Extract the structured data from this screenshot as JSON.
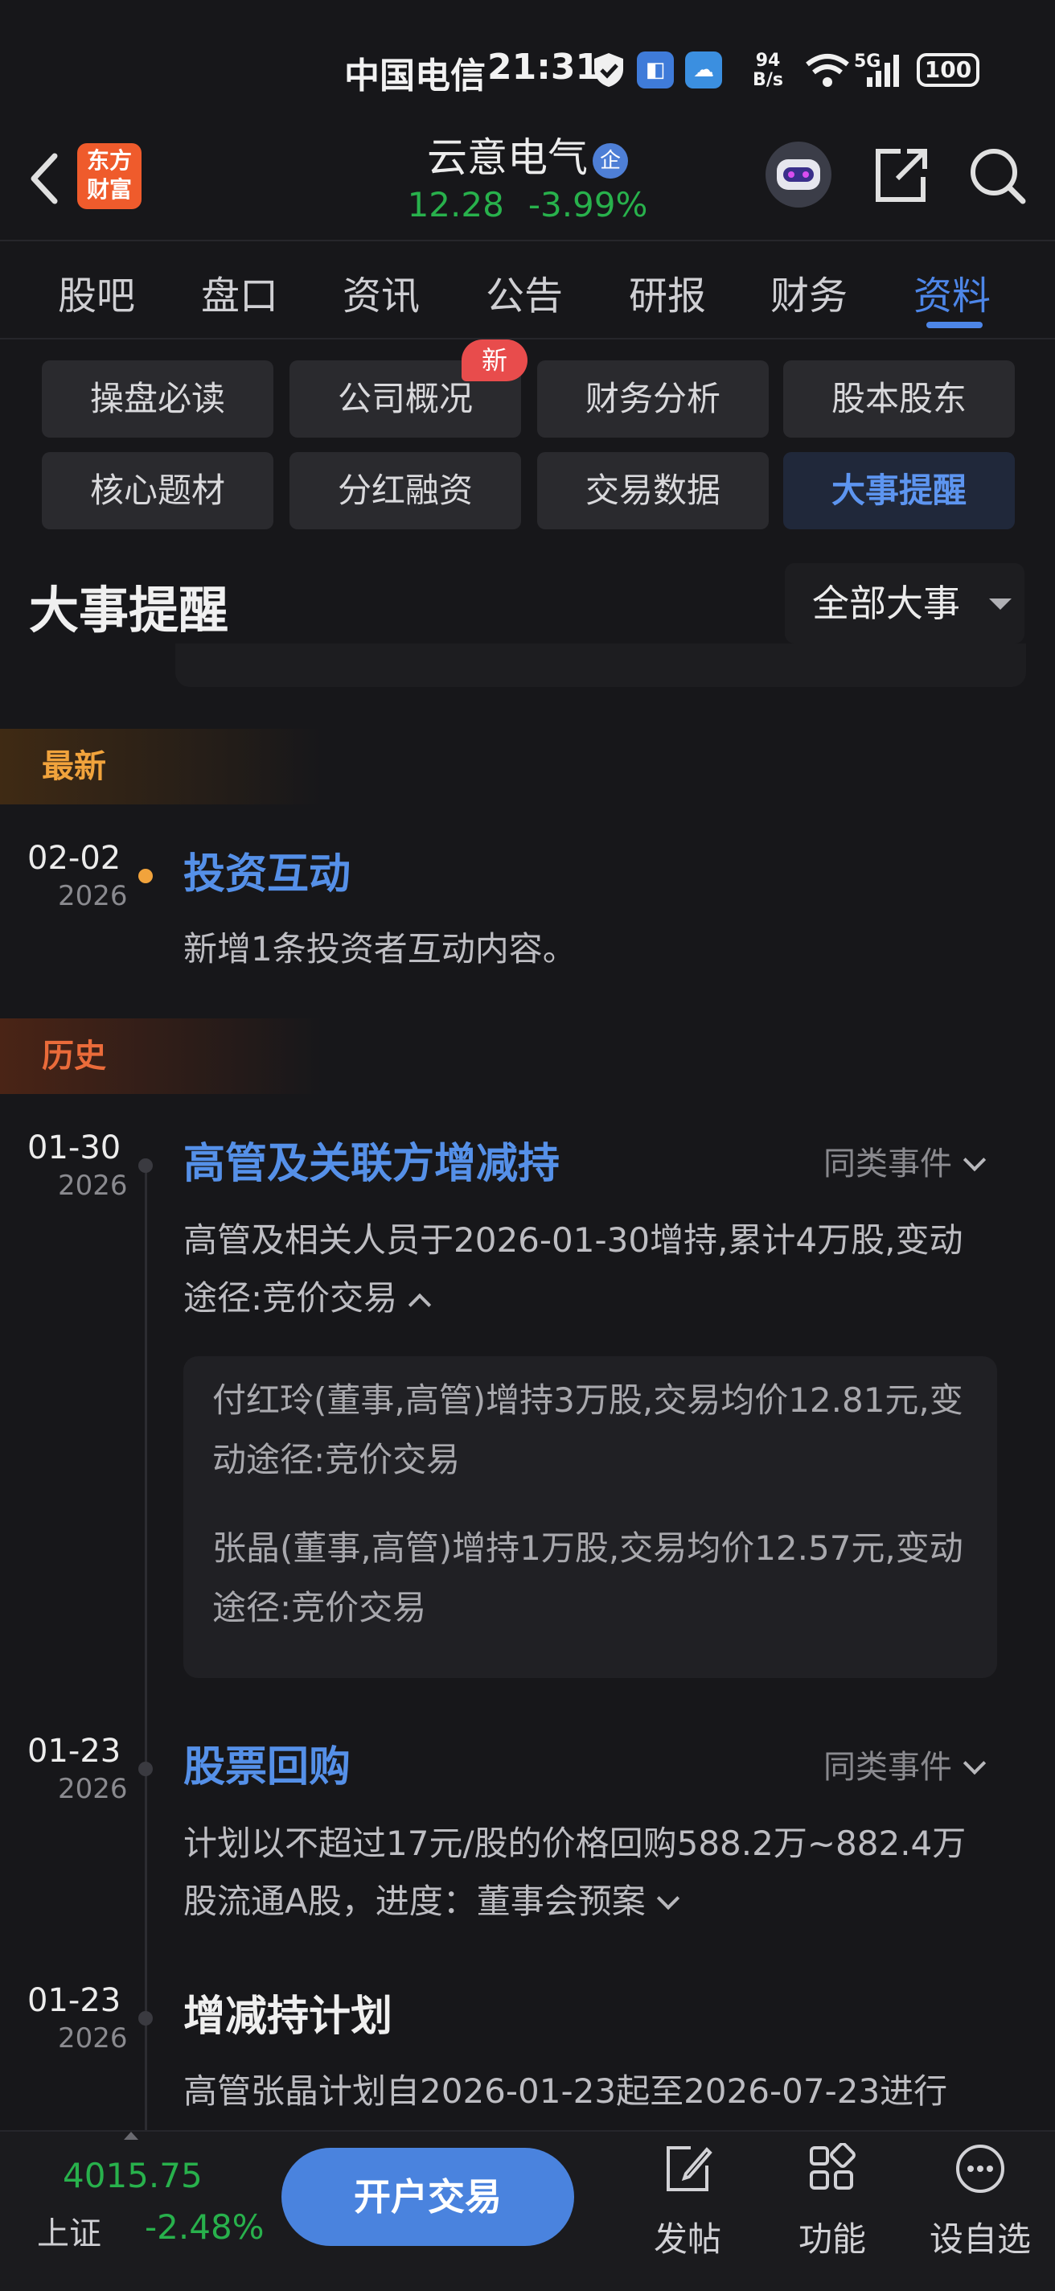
{
  "status_bar": {
    "carrier": "中国电信",
    "time": "21:31",
    "net_speed_top": "94",
    "net_speed_bottom": "B/s",
    "signal": "5G",
    "battery": "100"
  },
  "header": {
    "logo_text_line1": "东方",
    "logo_text_line2": "财富",
    "stock_name": "云意电气",
    "verified_badge": "企",
    "price": "12.28",
    "change_pct": "-3.99%"
  },
  "tabs": [
    {
      "label": "股吧"
    },
    {
      "label": "盘口"
    },
    {
      "label": "资讯"
    },
    {
      "label": "公告"
    },
    {
      "label": "研报"
    },
    {
      "label": "财务"
    },
    {
      "label": "资料"
    }
  ],
  "active_tab": "资料",
  "chips": [
    {
      "label": "操盘必读"
    },
    {
      "label": "公司概况"
    },
    {
      "label": "财务分析"
    },
    {
      "label": "股本股东"
    },
    {
      "label": "核心题材"
    },
    {
      "label": "分红融资"
    },
    {
      "label": "交易数据"
    },
    {
      "label": "大事提醒"
    }
  ],
  "new_badge": "新",
  "section": {
    "title": "大事提醒",
    "filter_label": "全部大事"
  },
  "groups": {
    "latest": "最新",
    "history": "历史"
  },
  "events": [
    {
      "date": "02-02",
      "year": "2026",
      "title": "投资互动",
      "desc": "新增1条投资者互动内容。"
    },
    {
      "date": "01-30",
      "year": "2026",
      "title": "高管及关联方增减持",
      "similar": "同类事件",
      "desc": "高管及相关人员于2026-01-30增持,累计4万股,变动途径:竞价交易",
      "details": [
        "付红玲(董事,高管)增持3万股,交易均价12.81元,变动途径:竞价交易",
        "张晶(董事,高管)增持1万股,交易均价12.57元,变动途径:竞价交易"
      ]
    },
    {
      "date": "01-23",
      "year": "2026",
      "title": "股票回购",
      "similar": "同类事件",
      "desc": "计划以不超过17元/股的价格回购588.2万~882.4万股流通A股，进度：董事会预案"
    },
    {
      "date": "01-23",
      "year": "2026",
      "title": "增减持计划",
      "desc": "高管张晶计划自2026-01-23起至2026-07-23进行"
    }
  ],
  "bottom_bar": {
    "index_value": "4015.75",
    "index_name": "上证",
    "index_change": "-2.48%",
    "trade_button": "开户交易",
    "post": "发帖",
    "function": "功能",
    "watchlist": "设自选"
  },
  "colors": {
    "accent": "#4d86e8",
    "down_green": "#28b14c",
    "brand_orange": "#ef5b2c"
  }
}
